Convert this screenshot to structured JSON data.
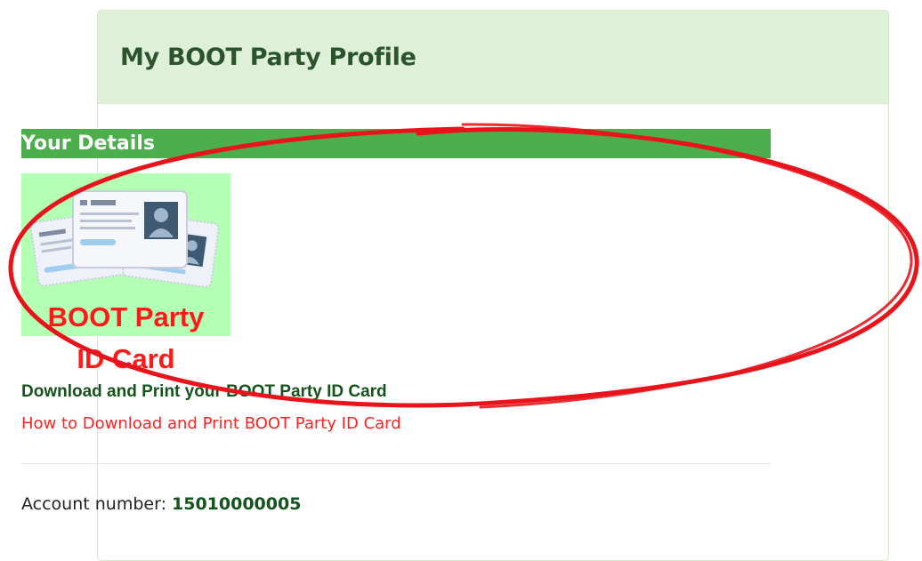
{
  "panel": {
    "title": "My BOOT Party Profile"
  },
  "details": {
    "section_title": "Your Details",
    "id_card_image_text": "BOOT Party\nID Card",
    "download_label": "Download and Print your BOOT Party ID Card",
    "howto_link": "How to Download and Print BOOT Party ID Card"
  },
  "account": {
    "label": "Account number: ",
    "number": "15010000005"
  },
  "colors": {
    "heading_bg": "#dff0d8",
    "heading_text": "#2b542c",
    "section_bar": "#4cae4c",
    "card_bg": "#b3ffb3",
    "card_text": "#ff1a1a",
    "link": "#ff2222",
    "annotation_ellipse": "#e8141c"
  }
}
